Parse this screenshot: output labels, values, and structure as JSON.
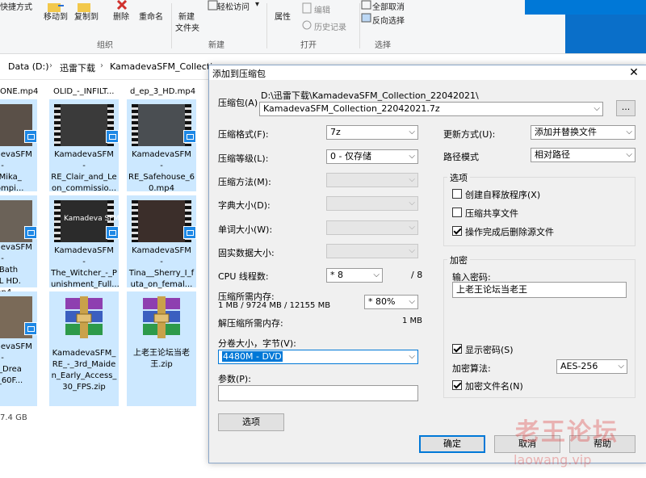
{
  "ribbon": {
    "quick_access": "快捷方式",
    "move_to": "移动到",
    "copy_to": "复制到",
    "delete": "删除",
    "rename": "重命名",
    "new_folder_1": "新建",
    "new_folder_2": "文件夹",
    "easy_access": "轻松访问",
    "properties": "属性",
    "edit": "编辑",
    "history": "历史记录",
    "select_all": "全部取消",
    "invert_selection": "反向选择",
    "group_organize": "组织",
    "group_new": "新建",
    "group_open": "打开",
    "group_select": "选择"
  },
  "breadcrumb": [
    "Data (D:)",
    "迅雷下载",
    "KamadevaSFM_Collectio"
  ],
  "files": {
    "top_captions": [
      "ONE.mp4",
      "OLID_-_INFILT...",
      "d_ep_3_HD.mp4"
    ],
    "row1": [
      "KamadevaSFM\n-\now_Mika_\nu_Compi...",
      "KamadevaSFM\n-\nRE_Clair_and_Le\non_commissio...",
      "KamadevaSFM\n-\nRE_Safehouse_6\n0.mp4"
    ],
    "row2": [
      "KamadevaSFM\n-\nxy Bath\nFULL HD.\nmp4",
      "KamadevaSFM\n-\nThe_Witcher_-_P\nunishment_Full...",
      "KamadevaSFM\n-\nTina__Sherry_I_f\nuta_on_femal..."
    ],
    "row3": [
      "KamadevaSFM\n-\nfers_Drea\n30p_60F...",
      "KamadevaSFM_\nRE_-_3rd_Maide\nn_Early_Access_\n30_FPS.zip",
      "上老王论坛当老\n王.zip"
    ],
    "thumb_overlay": "Kamadeva SFM",
    "status": "7.4 GB"
  },
  "dialog": {
    "title": "添加到压缩包",
    "close": "✕",
    "archive_label": "压缩包(A)",
    "archive_dir": "D:\\迅雷下载\\KamadevaSFM_Collection_22042021\\",
    "archive_name": "KamadevaSFM_Collection_22042021.7z",
    "browse": "...",
    "format_label": "压缩格式(F):",
    "format_value": "7z",
    "level_label": "压缩等级(L):",
    "level_value": "0 - 仅存储",
    "method_label": "压缩方法(M):",
    "dict_label": "字典大小(D):",
    "word_label": "单词大小(W):",
    "solid_label": "固实数据大小:",
    "cpu_label": "CPU 线程数:",
    "cpu_value": "* 8",
    "cpu_total": "/ 8",
    "mem_label": "压缩所需内存:",
    "mem_value": "1 MB / 9724 MB / 12155 MB",
    "mem_percent": "* 80%",
    "decomp_label": "解压缩所需内存:",
    "decomp_value": "1 MB",
    "split_label": "分卷大小，字节(V):",
    "split_value": "4480M - DVD",
    "params_label": "参数(P):",
    "params_value": "",
    "options_button": "选项",
    "update_label": "更新方式(U):",
    "update_value": "添加并替换文件",
    "path_label": "路径模式",
    "path_value": "相对路径",
    "options_group": "选项",
    "opt_sfx": "创建自释放程序(X)",
    "opt_shared": "压缩共享文件",
    "opt_delete": "操作完成后删除源文件",
    "encrypt_group": "加密",
    "password_label": "输入密码:",
    "password_value": "上老王论坛当老王",
    "show_password": "显示密码(S)",
    "enc_method_label": "加密算法:",
    "enc_method_value": "AES-256",
    "enc_names": "加密文件名(N)",
    "ok": "确定",
    "cancel": "取消",
    "help": "帮助"
  },
  "checkboxes": {
    "opt_sfx": false,
    "opt_shared": false,
    "opt_delete": true,
    "show_password": true,
    "enc_names": true
  },
  "watermark": {
    "cn": "老王论坛",
    "en": "laowang.vip"
  }
}
